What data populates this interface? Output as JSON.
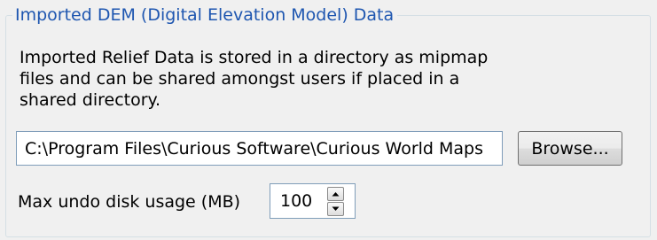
{
  "group": {
    "title": "Imported DEM (Digital Elevation Model) Data",
    "description": "Imported Relief Data is stored in a directory as mipmap files and can be shared amongst users if placed in a shared directory."
  },
  "directory": {
    "value": "C:\\Program Files\\Curious Software\\Curious World Maps",
    "browse_label": "Browse..."
  },
  "undo": {
    "label": "Max undo disk usage (MB)",
    "value": "100",
    "icons": {
      "up": "chevron-up-icon",
      "down": "chevron-down-icon"
    }
  },
  "colors": {
    "title": "#1e56b0",
    "border": "#d5dfe5",
    "field_border": "#7f9db9"
  }
}
